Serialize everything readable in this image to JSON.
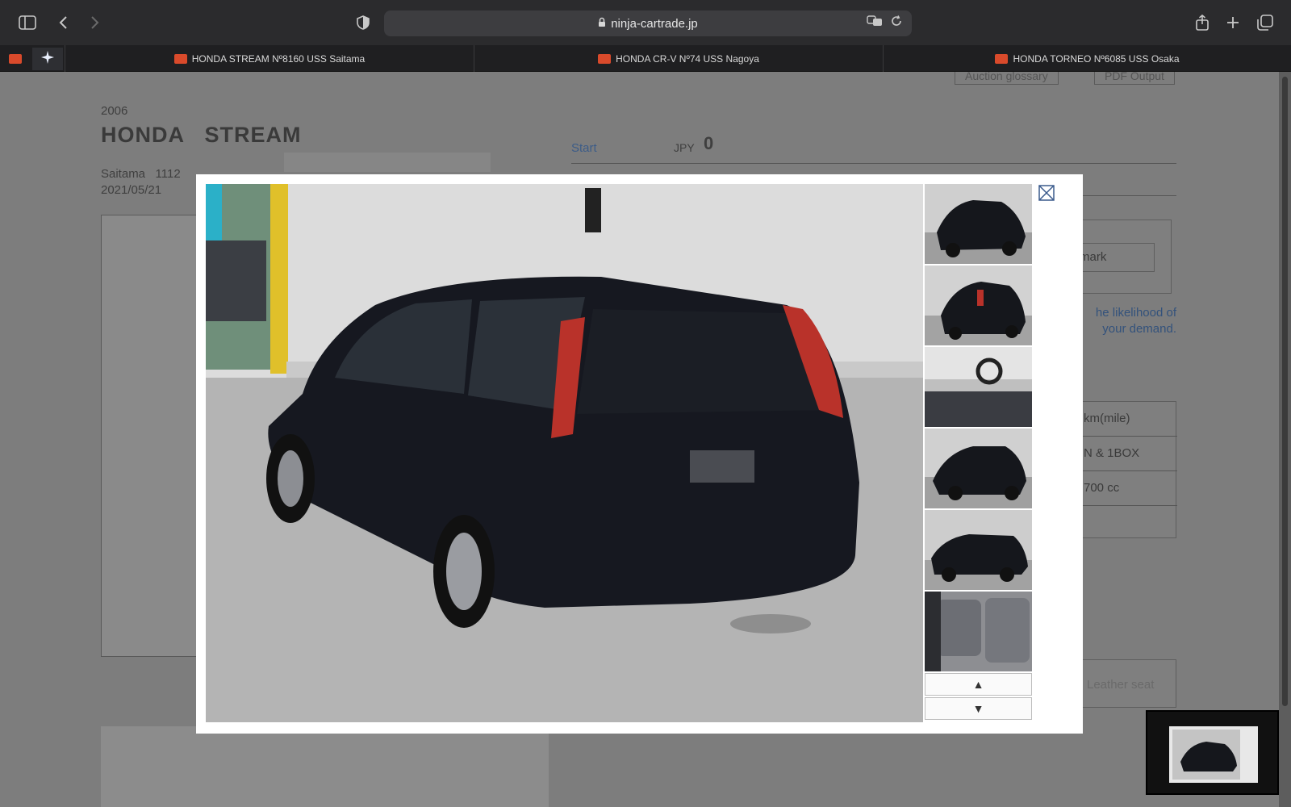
{
  "browser": {
    "url": "ninja-cartrade.jp",
    "tabs": [
      {
        "label": "HONDA STREAM Nº8160 USS Saitama"
      },
      {
        "label": "HONDA CR-V Nº74 USS Nagoya"
      },
      {
        "label": "HONDA TORNEO Nº6085 USS Osaka"
      }
    ]
  },
  "page": {
    "year": "2006",
    "model": "HONDA   STREAM",
    "location": "Saitama   1112",
    "date": "2021/05/21",
    "start_label": "Start",
    "currency": "JPY",
    "start_price": "0",
    "buttons": {
      "glossary": "Auction glossary",
      "pdf": "PDF Output"
    },
    "remark": "mark",
    "likelihood_text": [
      "he likelihood of",
      "your demand."
    ],
    "specs": [
      "km(mile)",
      "N & 1BOX",
      "700 cc"
    ],
    "leather": "Leather seat"
  },
  "gallery": {
    "up_label": "▲",
    "down_label": "▼",
    "thumbnail_count": 6
  },
  "colors": {
    "accent_blue": "#3c5c88",
    "car_body": "#161820",
    "tail_light": "#c0392b"
  }
}
